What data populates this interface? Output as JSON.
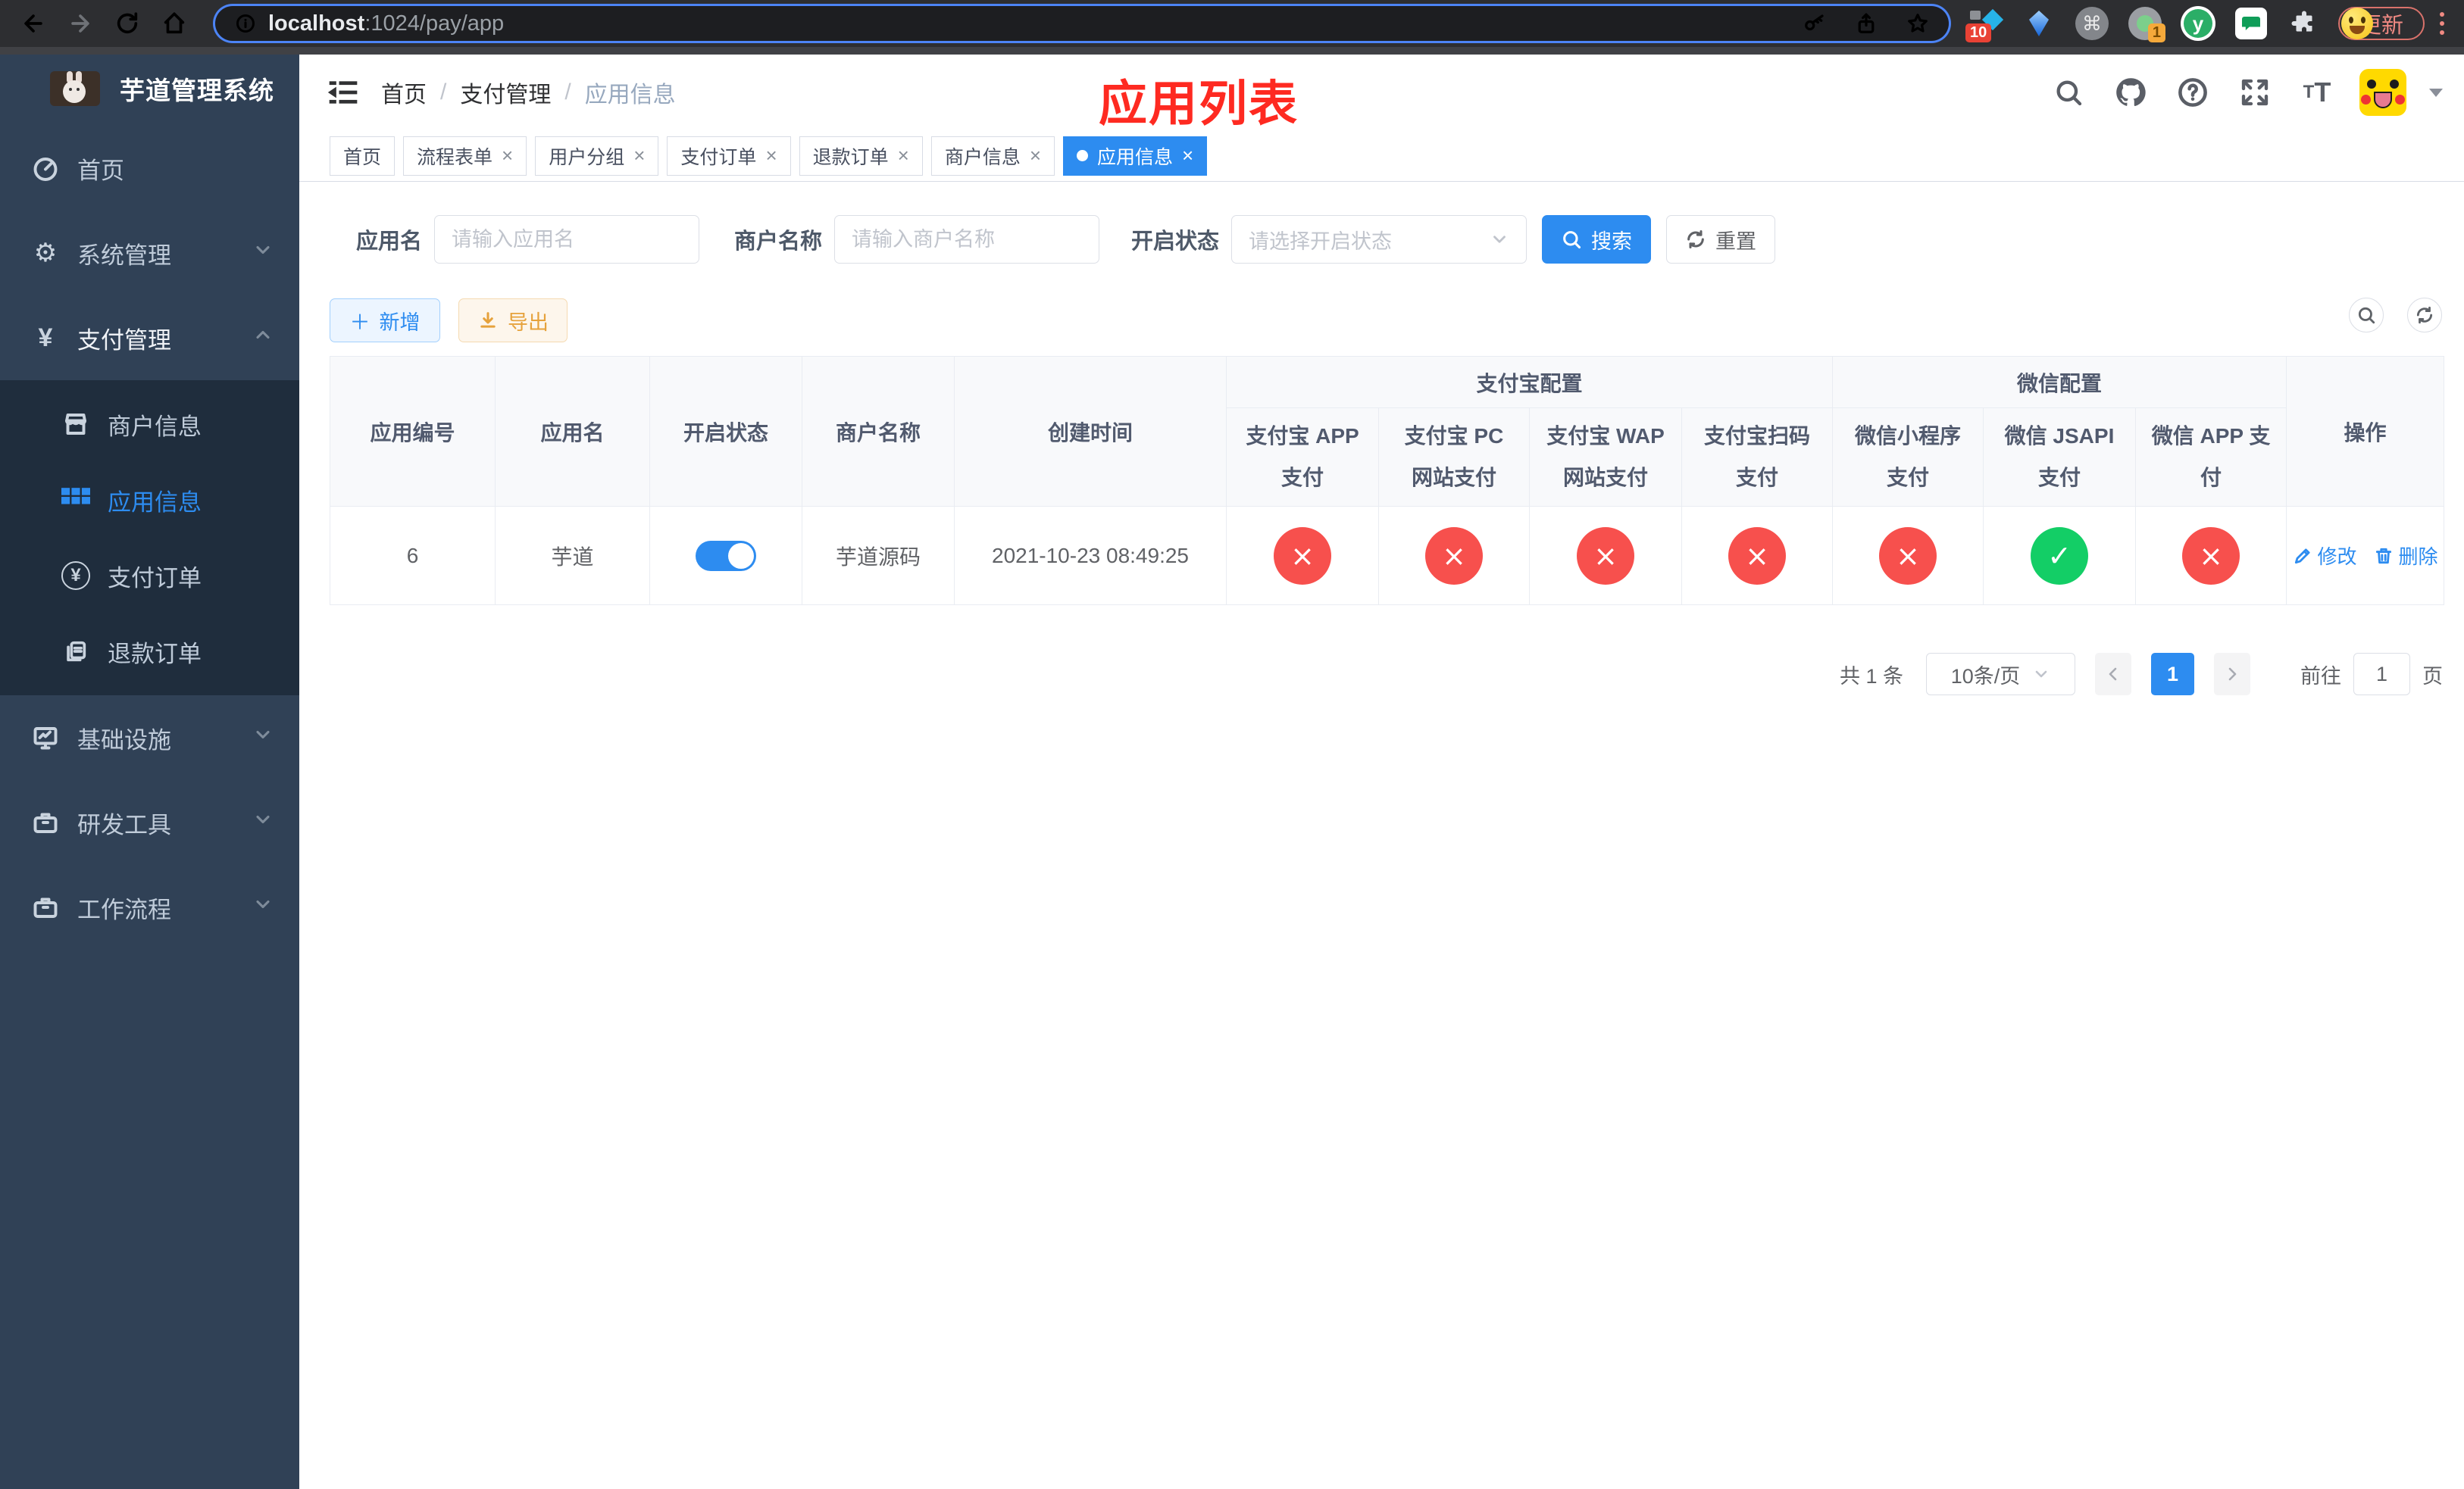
{
  "browser": {
    "url_host": "localhost",
    "url_rest": ":1024/pay/app",
    "update_label": "更新",
    "ext_badge_blue": "10",
    "ext_badge_orange": "1",
    "ext_command_glyph": "⌘",
    "ext_yuque_letter": "y"
  },
  "icons": {
    "close": "×",
    "check": "✓",
    "cross": "×",
    "plus": "＋",
    "yen": "¥",
    "gear": "⚙"
  },
  "sidebar": {
    "title": "芋道管理系统",
    "items": [
      {
        "label": "首页"
      },
      {
        "label": "系统管理"
      },
      {
        "label": "支付管理"
      },
      {
        "label": "基础设施"
      },
      {
        "label": "研发工具"
      },
      {
        "label": "工作流程"
      }
    ],
    "pay_children": [
      {
        "label": "商户信息"
      },
      {
        "label": "应用信息"
      },
      {
        "label": "支付订单"
      },
      {
        "label": "退款订单"
      }
    ]
  },
  "header": {
    "breadcrumb": [
      "首页",
      "支付管理",
      "应用信息"
    ],
    "overlay_title": "应用列表"
  },
  "tabs": [
    {
      "label": "首页"
    },
    {
      "label": "流程表单"
    },
    {
      "label": "用户分组"
    },
    {
      "label": "支付订单"
    },
    {
      "label": "退款订单"
    },
    {
      "label": "商户信息"
    },
    {
      "label": "应用信息"
    }
  ],
  "search": {
    "app_name_label": "应用名",
    "app_name_placeholder": "请输入应用名",
    "merchant_label": "商户名称",
    "merchant_placeholder": "请输入商户名称",
    "status_label": "开启状态",
    "status_placeholder": "请选择开启状态",
    "search_label": "搜索",
    "reset_label": "重置"
  },
  "toolbar": {
    "add_label": "新增",
    "export_label": "导出"
  },
  "table": {
    "col_app_id": "应用编号",
    "col_app_name": "应用名",
    "col_status": "开启状态",
    "col_merchant": "商户名称",
    "col_created": "创建时间",
    "group_alipay": "支付宝配置",
    "group_wechat": "微信配置",
    "sub_headers": [
      "支付宝 APP 支付",
      "支付宝 PC 网站支付",
      "支付宝 WAP 网站支付",
      "支付宝扫码支付",
      "微信小程序支付",
      "微信 JSAPI 支付",
      "微信 APP 支付"
    ],
    "col_ops": "操作",
    "row": {
      "id": "6",
      "name": "芋道",
      "enabled": true,
      "merchant": "芋道源码",
      "created": "2021-10-23 08:49:25",
      "pay_channels": [
        "fail",
        "fail",
        "fail",
        "fail",
        "fail",
        "success",
        "fail"
      ],
      "edit_label": "修改",
      "delete_label": "删除"
    }
  },
  "pagination": {
    "total": "共 1 条",
    "page_size": "10条/页",
    "page": "1",
    "goto_label": "前往",
    "goto_value": "1",
    "page_unit": "页"
  },
  "colors": {
    "primary": "#2d8cf0",
    "success": "#13ce66",
    "danger": "#f7504d",
    "warning": "#e6a23c",
    "sidebar": "#304156"
  }
}
